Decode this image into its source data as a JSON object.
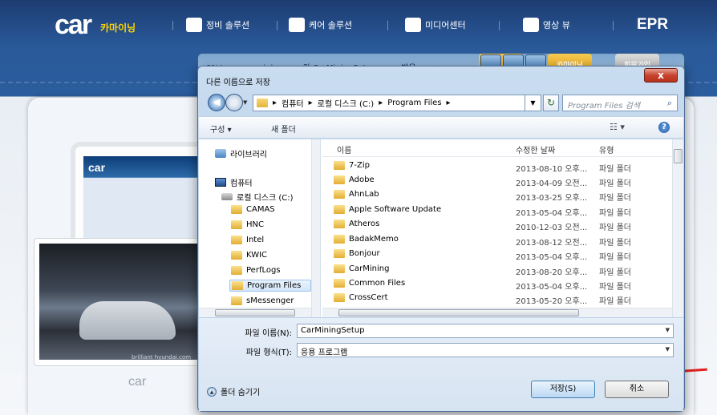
{
  "site": {
    "logo_text": "car",
    "logo_sub": "카마이닝",
    "nav": [
      {
        "label": "정비 솔루션"
      },
      {
        "label": "케어 솔루션"
      },
      {
        "label": "미디어센터"
      },
      {
        "label": "영상 뷰"
      }
    ],
    "epr": "EPR",
    "tablet_logo": "car",
    "monitor_logo": "car",
    "car_caption": "brilliant hyundai.com"
  },
  "behind_window": {
    "title": "0%/www.carmining.com의 CarMiningSetup.exe - 받은",
    "tab_orange": "카마이닝",
    "tab_gray": "회원가입"
  },
  "dialog": {
    "title": "다른 이름으로 저장",
    "close_label": "x",
    "address": {
      "crumbs": [
        "컴퓨터",
        "로컬 디스크 (C:)",
        "Program Files"
      ],
      "separator": "▸",
      "search_placeholder": "Program Files 검색"
    },
    "toolbar": {
      "organize": "구성 ▾",
      "new_folder": "새 폴더"
    },
    "nav_pane": {
      "library": "라이브러리",
      "computer": "컴퓨터",
      "local_disk": "로컬 디스크 (C:)",
      "folders": [
        "CAMAS",
        "HNC",
        "Intel",
        "KWIC",
        "PerfLogs",
        "Program Files",
        "sMessenger"
      ],
      "selected": "Program Files"
    },
    "file_list": {
      "columns": {
        "name": "이름",
        "date": "수정한 날짜",
        "type": "유형"
      },
      "rows": [
        {
          "name": "7-Zip",
          "date": "2013-08-10 오후...",
          "type": "파일 폴더"
        },
        {
          "name": "Adobe",
          "date": "2013-04-09 오전...",
          "type": "파일 폴더"
        },
        {
          "name": "AhnLab",
          "date": "2013-03-25 오후...",
          "type": "파일 폴더"
        },
        {
          "name": "Apple Software Update",
          "date": "2013-05-04 오후...",
          "type": "파일 폴더"
        },
        {
          "name": "Atheros",
          "date": "2010-12-03 오전...",
          "type": "파일 폴더"
        },
        {
          "name": "BadakMemo",
          "date": "2013-08-12 오전...",
          "type": "파일 폴더"
        },
        {
          "name": "Bonjour",
          "date": "2013-05-04 오후...",
          "type": "파일 폴더"
        },
        {
          "name": "CarMining",
          "date": "2013-08-20 오후...",
          "type": "파일 폴더"
        },
        {
          "name": "Common Files",
          "date": "2013-05-04 오후...",
          "type": "파일 폴더"
        },
        {
          "name": "CrossCert",
          "date": "2013-05-20 오후...",
          "type": "파일 폴더"
        }
      ]
    },
    "form": {
      "filename_label": "파일 이름(N):",
      "filename_value": "CarMiningSetup",
      "filetype_label": "파일 형식(T):",
      "filetype_value": "응용 프로그램",
      "hide_folders": "폴더 숨기기",
      "save": "저장(S)",
      "cancel": "취소"
    }
  },
  "colors": {
    "highlight": "#e32020",
    "header_bg": "#1d3c72",
    "accent_yellow": "#ffd400"
  }
}
